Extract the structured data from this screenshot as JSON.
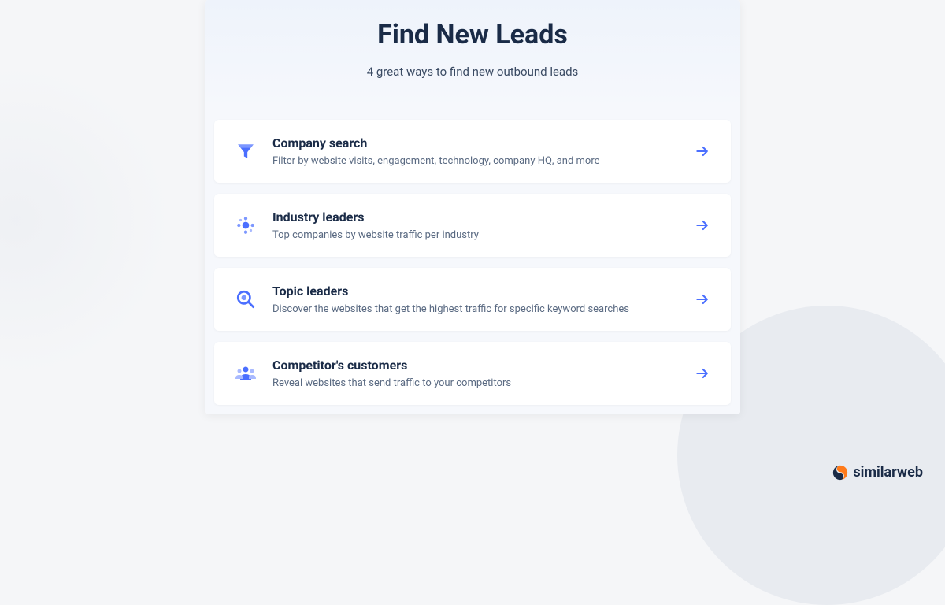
{
  "header": {
    "title": "Find New Leads",
    "subtitle": "4 great ways to find new outbound leads"
  },
  "options": [
    {
      "icon": "funnel-icon",
      "title": "Company search",
      "description": "Filter by website visits, engagement, technology, company HQ, and more"
    },
    {
      "icon": "nodes-icon",
      "title": "Industry leaders",
      "description": "Top companies by website traffic per industry"
    },
    {
      "icon": "magnifier-icon",
      "title": "Topic leaders",
      "description": "Discover the websites that get the highest traffic for specific keyword searches"
    },
    {
      "icon": "people-icon",
      "title": "Competitor's customers",
      "description": "Reveal websites that send traffic to your competitors"
    }
  ],
  "brand": {
    "name": "similarweb"
  },
  "colors": {
    "accent": "#4b6fff",
    "brandOrange": "#ff7a1a",
    "brandNavy": "#1a2b47"
  }
}
